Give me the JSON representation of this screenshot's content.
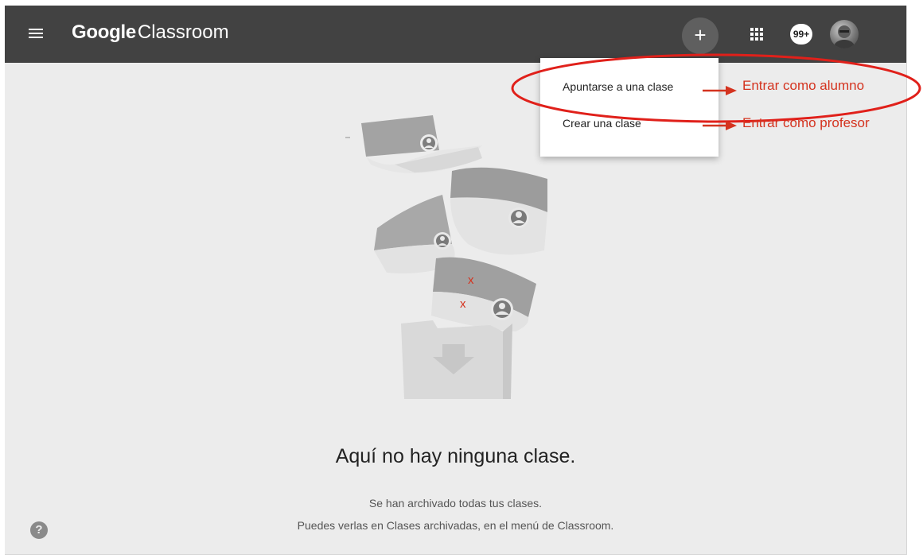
{
  "appbar": {
    "brand_google": "Google",
    "brand_classroom": "Classroom",
    "plus_label": "+",
    "notifications_badge": "99+"
  },
  "dropdown": {
    "items": [
      {
        "label": "Apuntarse a una clase"
      },
      {
        "label": "Crear una clase"
      }
    ]
  },
  "annotations": {
    "student": "Entrar como alumno",
    "teacher": "Entrar como profesor"
  },
  "illustration": {
    "marks": [
      "x",
      "x"
    ]
  },
  "empty_state": {
    "title": "Aquí no hay ninguna clase.",
    "line1": "Se han archivado todas tus clases.",
    "line2": "Puedes verlas en Clases archivadas, en el menú de Classroom."
  },
  "help": {
    "label": "?"
  },
  "colors": {
    "appbar": "#424242",
    "background": "#ececec",
    "annotation": "#d4331f"
  },
  "icons": {
    "menu": "hamburger-menu-icon",
    "apps": "apps-grid-icon",
    "help": "help-circle-icon",
    "arrow": "right-arrow-icon"
  }
}
